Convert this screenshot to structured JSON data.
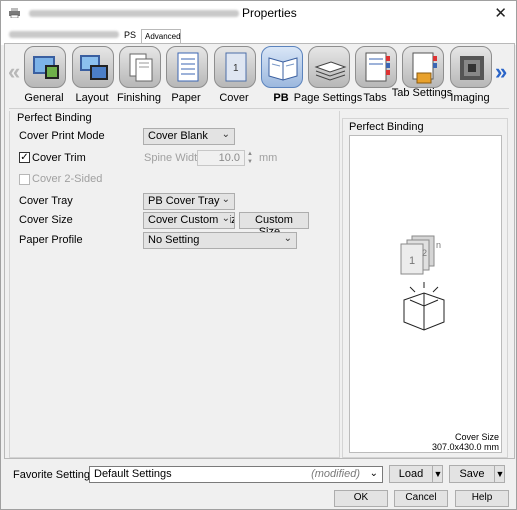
{
  "window": {
    "title": "Properties"
  },
  "tabs": [
    {
      "label": "PS"
    },
    {
      "label": "Advanced"
    }
  ],
  "categories": [
    {
      "label": "General"
    },
    {
      "label": "Layout"
    },
    {
      "label": "Finishing"
    },
    {
      "label": "Paper"
    },
    {
      "label": "Cover"
    },
    {
      "label": "PB"
    },
    {
      "label": "Page Settings"
    },
    {
      "label": "Tabs"
    },
    {
      "label": "Tab Settings"
    },
    {
      "label": "Imaging"
    }
  ],
  "perfect_binding": {
    "section_title": "Perfect Binding",
    "cover_print_mode": {
      "label": "Cover Print Mode",
      "value": "Cover Blank"
    },
    "cover_trim": {
      "label": "Cover Trim",
      "checked": true
    },
    "spine_width": {
      "label": "Spine Width",
      "value": "10.0",
      "unit": "mm"
    },
    "cover_2sided": {
      "label": "Cover 2-Sided",
      "checked": false
    },
    "cover_tray": {
      "label": "Cover Tray",
      "value": "PB Cover Tray"
    },
    "cover_size": {
      "label": "Cover Size",
      "value": "Cover Custom Size",
      "custom_button": "Custom Size..."
    },
    "paper_profile": {
      "label": "Paper Profile",
      "value": "No Setting"
    }
  },
  "preview": {
    "title": "Perfect Binding",
    "cover_size_label": "Cover Size",
    "cover_size_value": "307.0x430.0 mm",
    "pages": [
      "1",
      "2",
      "n"
    ]
  },
  "bottom": {
    "favorite_label": "Favorite Setting",
    "favorite_value": "Default Settings",
    "favorite_state": "(modified)",
    "load_label": "Load",
    "save_label": "Save",
    "ok_label": "OK",
    "cancel_label": "Cancel",
    "help_label": "Help"
  },
  "colors": {
    "selected_accent": "#5b83bd",
    "arrow_active": "#2a64c8"
  }
}
